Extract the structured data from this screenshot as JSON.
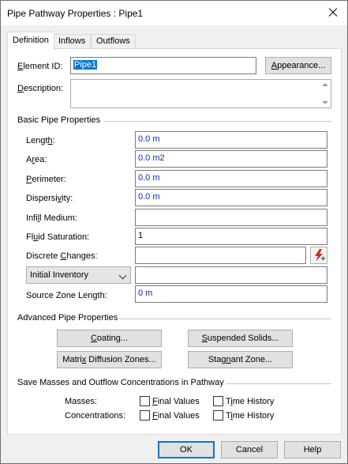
{
  "window": {
    "title": "Pipe Pathway Properties : Pipe1"
  },
  "tabs": [
    {
      "label": "Definition"
    },
    {
      "label": "Inflows"
    },
    {
      "label": "Outflows"
    }
  ],
  "element": {
    "id_label_u": "E",
    "id_label_rest": "lement ID:",
    "id_value": "Pipe1",
    "appearance_u": "A",
    "appearance_rest": "ppearance...",
    "description_u": "D",
    "description_rest": "escription:",
    "description_value": ""
  },
  "basic": {
    "heading": "Basic Pipe Properties",
    "length_label_a": "Lengt",
    "length_u": "h",
    "length_label_b": ":",
    "length_value": "0.0 m",
    "area_label_a": "A",
    "area_u": "r",
    "area_label_b": "ea:",
    "area_value": "0.0 m2",
    "perimeter_u": "P",
    "perimeter_label_b": "erimeter:",
    "perimeter_value": "0.0 m",
    "dispersivity_label_a": "Dispersi",
    "dispersivity_u": "v",
    "dispersivity_label_b": "ity:",
    "dispersivity_value": "0.0 m",
    "infill_label_a": "Infi",
    "infill_u": "l",
    "infill_label_b": "l Medium:",
    "infill_value": "",
    "saturation_label_a": "Fl",
    "saturation_u": "u",
    "saturation_label_b": "id Saturation:",
    "saturation_value": "1",
    "discrete_label_a": "Discrete ",
    "discrete_u": "C",
    "discrete_label_b": "hanges:",
    "discrete_value": "",
    "inventory_selected": "Initial Inventory",
    "inventory_value": "",
    "source_label": "Source Zone Length:",
    "source_value": "0 m"
  },
  "advanced": {
    "heading": "Advanced Pipe Properties",
    "coating_u": "C",
    "coating_rest": "oating...",
    "suspended_u": "S",
    "suspended_rest": "uspended Solids...",
    "matrix_label_a": "Matri",
    "matrix_u": "x",
    "matrix_label_b": " Diffusion Zones...",
    "stagnant_label_a": "Stag",
    "stagnant_u": "n",
    "stagnant_label_b": "ant Zone..."
  },
  "save": {
    "heading": "Save Masses and Outflow Concentrations in Pathway",
    "masses_label": "Masses:",
    "concentrations_label": "Concentrations:",
    "final_u": "F",
    "final_rest": "inal Values",
    "time_label_a": "T",
    "time_u": "i",
    "time_label_b": "me History",
    "final2_u": "F",
    "final2_rest": "inal Values",
    "time2_label_a": "T",
    "time2_u": "i",
    "time2_label_b": "me History",
    "masses_final": false,
    "masses_time": false,
    "conc_final": false,
    "conc_time": false
  },
  "footer": {
    "ok": "OK",
    "cancel": "Cancel",
    "help": "Help"
  },
  "colors": {
    "accent": "#0078d7",
    "value_text": "#0b2bb3",
    "wizard_red": "#d9261c",
    "wizard_green": "#2e9e3e"
  }
}
